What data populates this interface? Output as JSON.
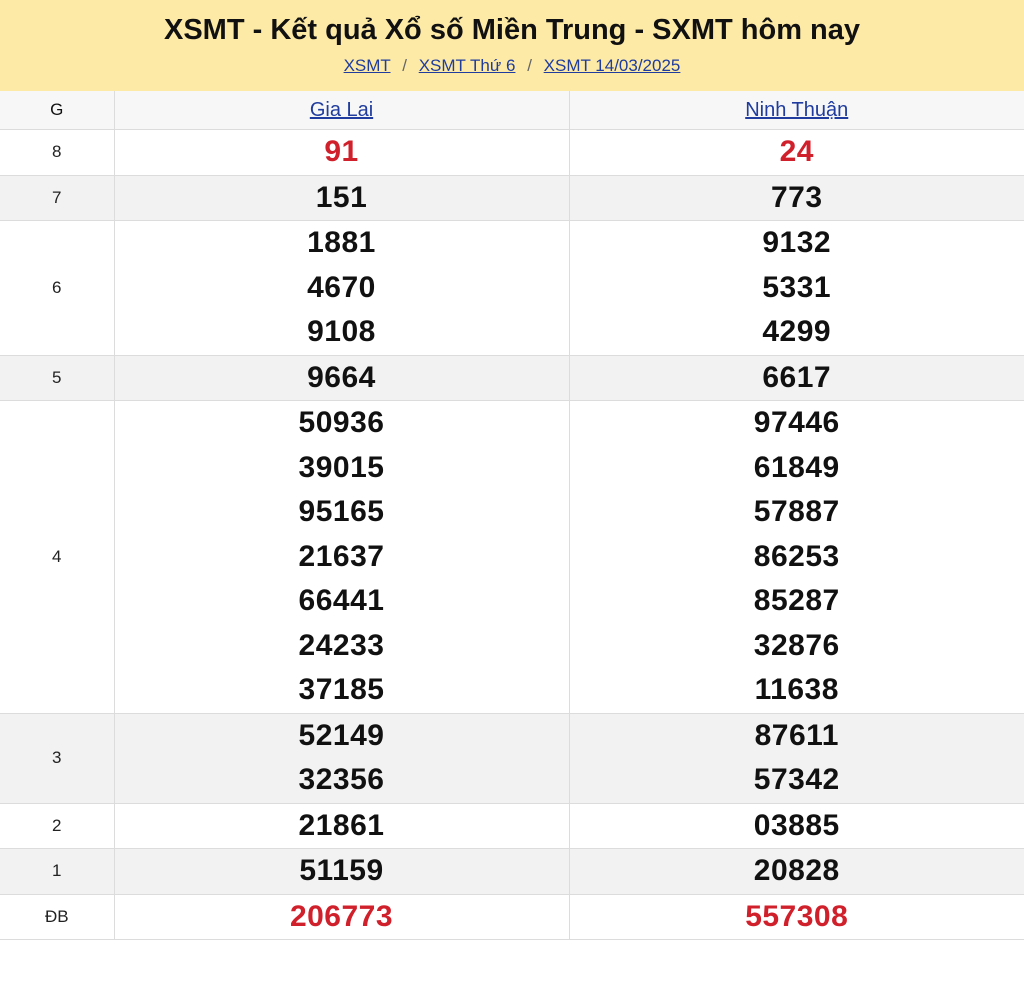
{
  "header": {
    "title": "XSMT - Kết quả Xổ số Miền Trung - SXMT hôm nay",
    "breadcrumbs": [
      "XSMT",
      "XSMT Thứ 6",
      "XSMT 14/03/2025"
    ]
  },
  "table": {
    "col_header": "G",
    "provinces": [
      "Gia Lai",
      "Ninh Thuận"
    ],
    "rows": [
      {
        "prize": "8",
        "red": true,
        "values": [
          [
            "91"
          ],
          [
            "24"
          ]
        ]
      },
      {
        "prize": "7",
        "red": false,
        "values": [
          [
            "151"
          ],
          [
            "773"
          ]
        ]
      },
      {
        "prize": "6",
        "red": false,
        "values": [
          [
            "1881",
            "4670",
            "9108"
          ],
          [
            "9132",
            "5331",
            "4299"
          ]
        ]
      },
      {
        "prize": "5",
        "red": false,
        "values": [
          [
            "9664"
          ],
          [
            "6617"
          ]
        ]
      },
      {
        "prize": "4",
        "red": false,
        "values": [
          [
            "50936",
            "39015",
            "95165",
            "21637",
            "66441",
            "24233",
            "37185"
          ],
          [
            "97446",
            "61849",
            "57887",
            "86253",
            "85287",
            "32876",
            "11638"
          ]
        ]
      },
      {
        "prize": "3",
        "red": false,
        "values": [
          [
            "52149",
            "32356"
          ],
          [
            "87611",
            "57342"
          ]
        ]
      },
      {
        "prize": "2",
        "red": false,
        "values": [
          [
            "21861"
          ],
          [
            "03885"
          ]
        ]
      },
      {
        "prize": "1",
        "red": false,
        "values": [
          [
            "51159"
          ],
          [
            "20828"
          ]
        ]
      },
      {
        "prize": "ĐB",
        "red": true,
        "values": [
          [
            "206773"
          ],
          [
            "557308"
          ]
        ]
      }
    ]
  },
  "colors": {
    "header_bg": "#fdeaa6",
    "link": "#1f3c9e",
    "highlight_red": "#d0202b"
  }
}
